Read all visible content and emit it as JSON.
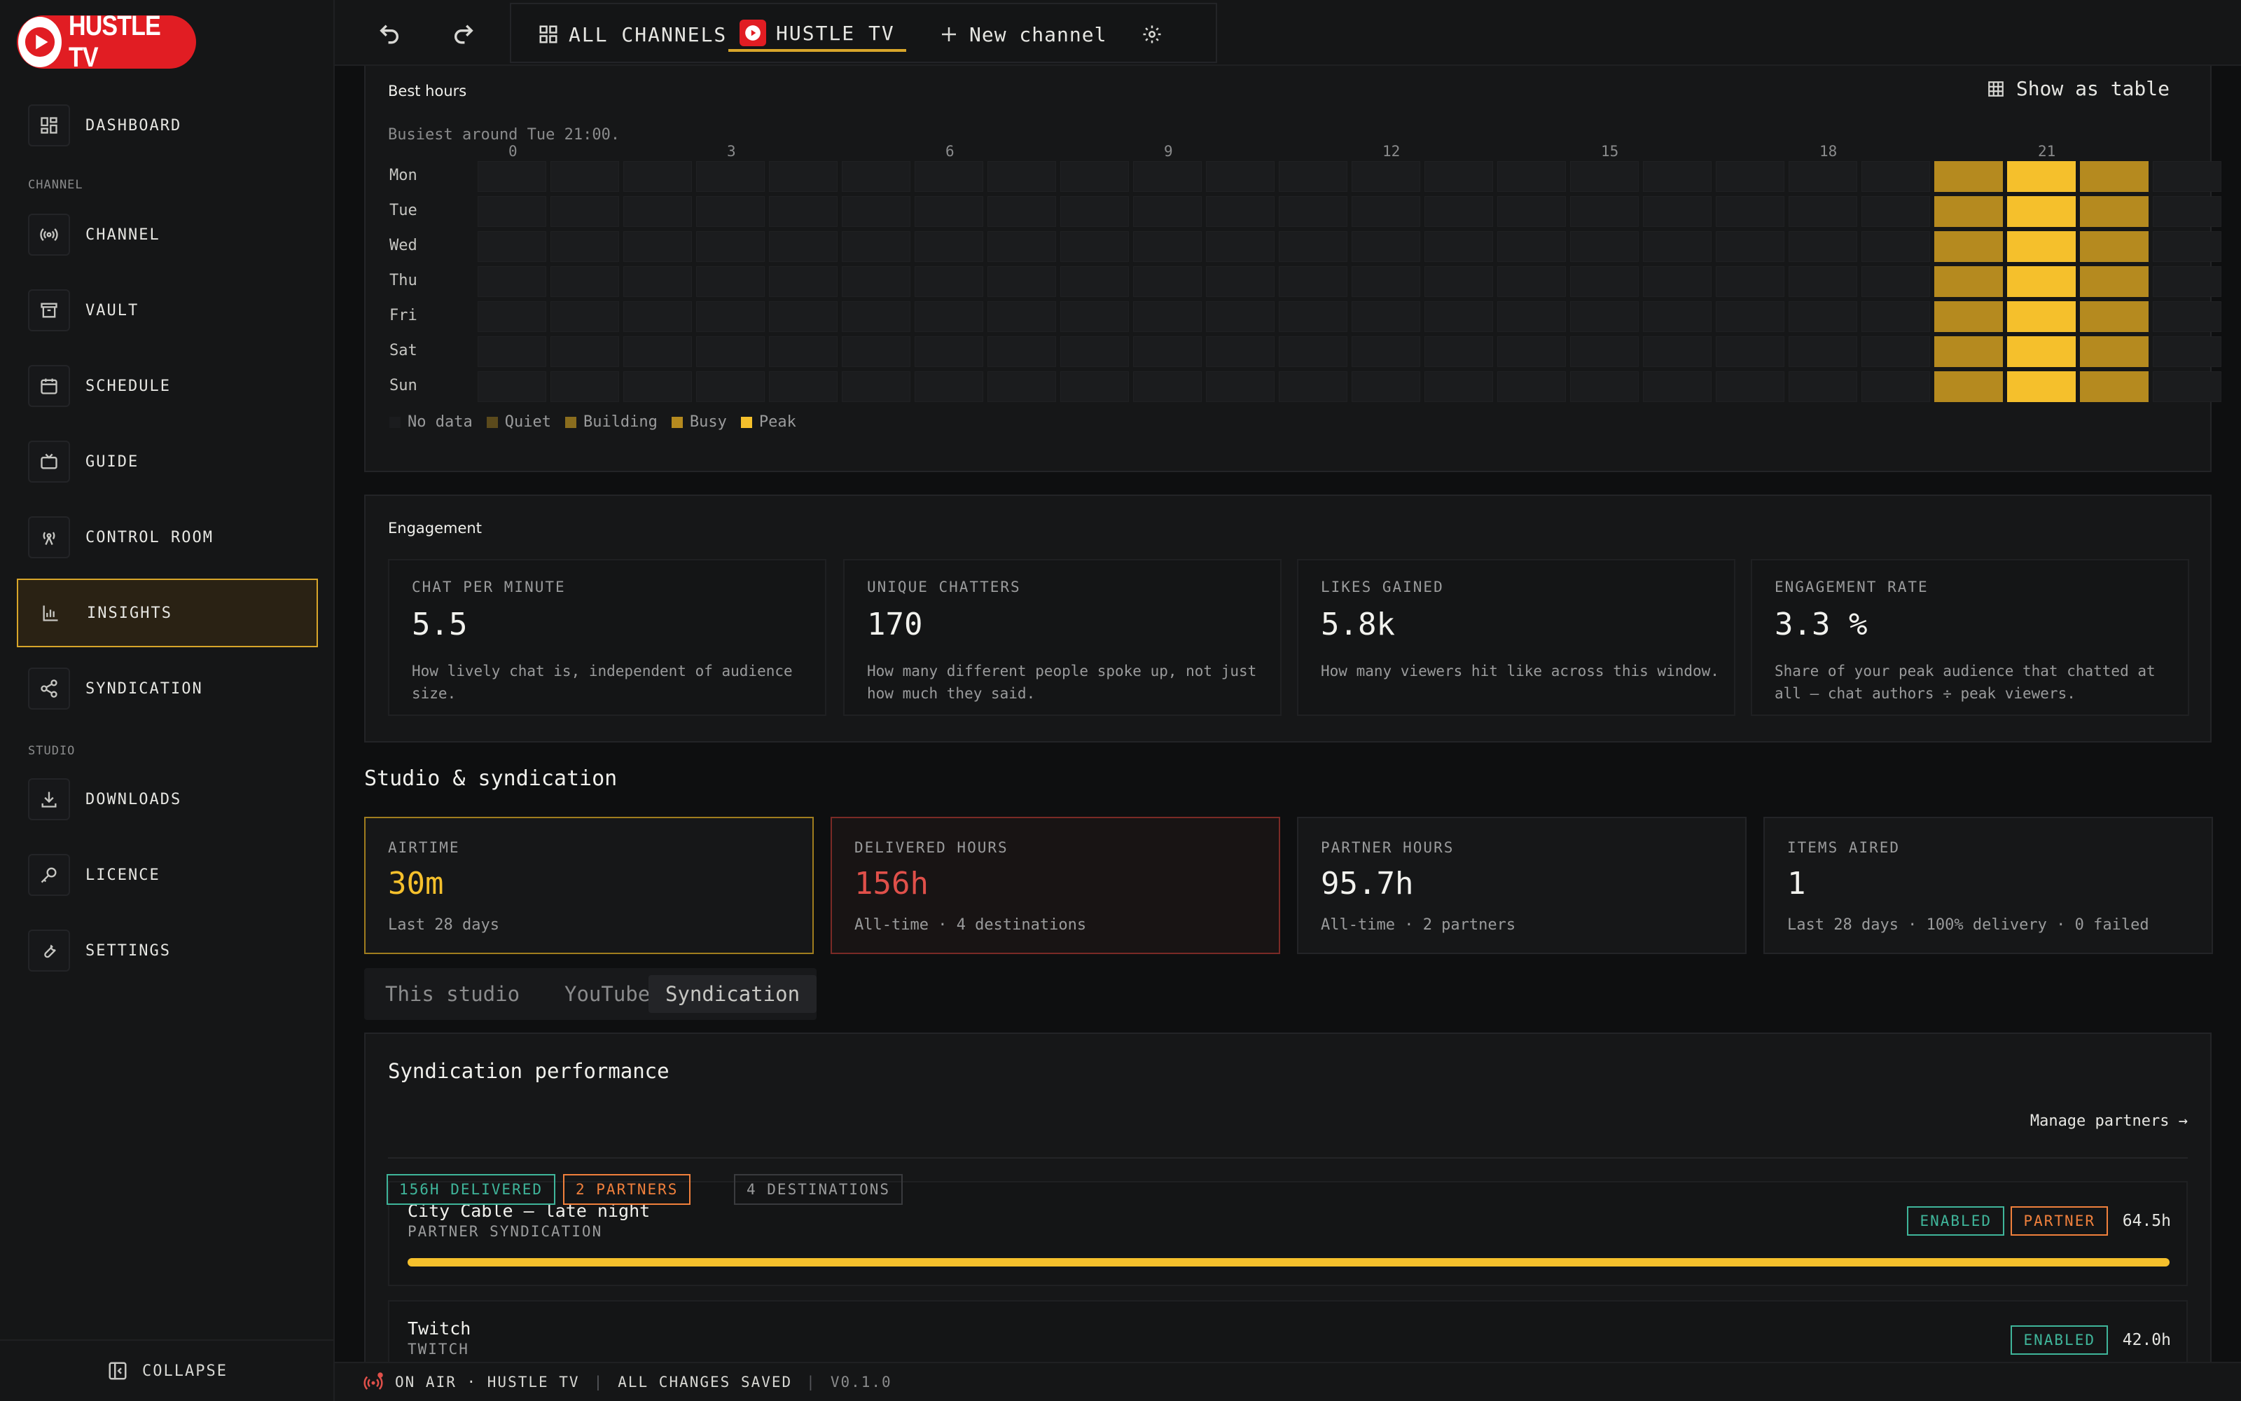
{
  "brand": {
    "logo_text": "HUSTLE TV"
  },
  "sidebar": {
    "items": [
      {
        "label": "DASHBOARD",
        "icon": "dashboard-icon"
      },
      {
        "label": "CHANNEL",
        "icon": "broadcast-icon"
      },
      {
        "label": "VAULT",
        "icon": "archive-icon"
      },
      {
        "label": "SCHEDULE",
        "icon": "calendar-icon"
      },
      {
        "label": "GUIDE",
        "icon": "tv-icon"
      },
      {
        "label": "CONTROL ROOM",
        "icon": "antenna-icon"
      },
      {
        "label": "INSIGHTS",
        "icon": "bar-chart-icon",
        "active": true
      },
      {
        "label": "SYNDICATION",
        "icon": "share-icon"
      },
      {
        "label": "DOWNLOADS",
        "icon": "download-icon"
      },
      {
        "label": "LICENCE",
        "icon": "key-icon"
      },
      {
        "label": "SETTINGS",
        "icon": "wrench-icon"
      }
    ],
    "sections": {
      "channel": "CHANNEL",
      "studio": "STUDIO"
    },
    "collapse_label": "COLLAPSE"
  },
  "topbar": {
    "tabs": [
      {
        "label": "ALL CHANNELS",
        "icon": "grid-icon"
      },
      {
        "label": "HUSTLE TV",
        "icon": "play-logo-icon",
        "active": true
      },
      {
        "label": "New channel",
        "icon": "plus-icon"
      }
    ]
  },
  "best_hours": {
    "title": "Best hours",
    "subtitle": "Busiest around Tue 21:00.",
    "show_table": "Show as table",
    "hour_ticks": [
      "0",
      "3",
      "6",
      "9",
      "12",
      "15",
      "18",
      "21"
    ],
    "days": [
      "Mon",
      "Tue",
      "Wed",
      "Thu",
      "Fri",
      "Sat",
      "Sun"
    ],
    "levels_by_hour": {
      "20": "busy",
      "21": "peak",
      "22": "busy"
    },
    "legend": [
      {
        "label": "No data",
        "color": "#1b1c1e"
      },
      {
        "label": "Quiet",
        "color": "#5b4a1c"
      },
      {
        "label": "Building",
        "color": "#8a6d1e"
      },
      {
        "label": "Busy",
        "color": "#b58a1f"
      },
      {
        "label": "Peak",
        "color": "#f5c02c"
      }
    ]
  },
  "engagement": {
    "title": "Engagement",
    "cards": [
      {
        "title": "CHAT PER MINUTE",
        "value": "5.5",
        "desc": "How lively chat is, independent of audience size."
      },
      {
        "title": "UNIQUE CHATTERS",
        "value": "170",
        "desc": "How many different people spoke up, not just how much they said."
      },
      {
        "title": "LIKES GAINED",
        "value": "5.8k",
        "desc": "How many viewers hit like across this window."
      },
      {
        "title": "ENGAGEMENT RATE",
        "value": "3.3 %",
        "desc": "Share of your peak audience that chatted at all — chat authors ÷ peak viewers."
      }
    ]
  },
  "studio": {
    "title": "Studio & syndication",
    "kpis": [
      {
        "title": "AIRTIME",
        "value": "30m",
        "desc": "Last 28 days",
        "accent": "#f5c02c",
        "border": "#a07d1e"
      },
      {
        "title": "DELIVERED HOURS",
        "value": "156h",
        "desc": "All-time · 4 destinations",
        "accent": "#e0504a",
        "border": "#7a2a26"
      },
      {
        "title": "PARTNER HOURS",
        "value": "95.7h",
        "desc": "All-time · 2 partners",
        "accent": "#f2f2ee",
        "border": "#232427"
      },
      {
        "title": "ITEMS AIRED",
        "value": "1",
        "desc": "Last 28 days · 100% delivery · 0 failed",
        "accent": "#f2f2ee",
        "border": "#232427"
      }
    ],
    "tabs": [
      {
        "label": "This studio"
      },
      {
        "label": "YouTube"
      },
      {
        "label": "Syndication",
        "active": true
      }
    ]
  },
  "syndication": {
    "title": "Syndication performance",
    "chips": [
      {
        "label": "156H DELIVERED",
        "color": "#3fb59a"
      },
      {
        "label": "2 PARTNERS",
        "color": "#f0803c"
      },
      {
        "label": "4 DESTINATIONS",
        "color": "#9a9b9c"
      }
    ],
    "manage": "Manage partners →",
    "rows": [
      {
        "name": "City Cable — late night",
        "kind": "PARTNER SYNDICATION",
        "enabled": "ENABLED",
        "partner": "PARTNER",
        "hours": "64.5h",
        "progress": 1.0
      },
      {
        "name": "Twitch",
        "kind": "TWITCH",
        "enabled": "ENABLED",
        "hours": "42.0h"
      }
    ]
  },
  "statusbar": {
    "on_air": "ON AIR · HUSTLE TV",
    "saved": "ALL CHANGES SAVED",
    "version": "V0.1.0"
  },
  "colors": {
    "accent": "#d8a62a",
    "peak": "#f5c02c",
    "busy": "#b58a1f",
    "brand_red": "#e11d23"
  }
}
